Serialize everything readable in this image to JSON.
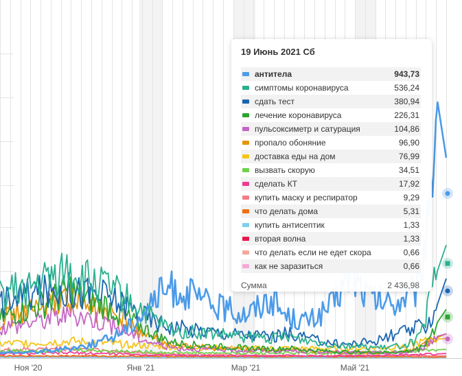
{
  "chart_data": {
    "type": "line",
    "x_tick_labels": [
      "Ноя '20",
      "Янв '21",
      "Мар '21",
      "Май '21"
    ],
    "x_range": [
      "2020-10-01",
      "2021-06-25"
    ],
    "y_range": [
      0,
      1100
    ],
    "grid": "vertical-weekly",
    "weekend_shading": true,
    "tooltip": {
      "date_label": "19 Июнь 2021 Сб",
      "total_label": "Сумма",
      "total_value": "2 436,98"
    },
    "series": [
      {
        "name": "антитела",
        "color": "#4c9be8",
        "value_label": "943,73",
        "values": [
          20,
          21,
          22,
          24,
          25,
          28,
          30,
          35,
          40,
          45,
          50,
          60,
          70,
          85,
          110,
          130,
          165,
          205,
          240,
          265,
          270,
          260,
          240,
          225,
          210,
          200,
          190,
          180,
          175,
          190,
          215,
          240,
          190,
          160,
          150,
          145,
          155,
          180,
          210,
          270,
          330,
          290,
          240,
          225,
          215,
          210,
          230,
          250,
          270,
          620,
          1000,
          780
        ]
      },
      {
        "name": "симптомы коронавируса",
        "color": "#2ab08f",
        "value_label": "536,24",
        "values": [
          240,
          255,
          265,
          270,
          280,
          300,
          310,
          330,
          350,
          310,
          300,
          290,
          275,
          260,
          240,
          215,
          195,
          165,
          140,
          120,
          105,
          100,
          100,
          95,
          95,
          90,
          90,
          85,
          80,
          80,
          80,
          75,
          80,
          90,
          75,
          70,
          65,
          60,
          55,
          50,
          50,
          45,
          45,
          40,
          40,
          45,
          50,
          60,
          80,
          200,
          340,
          440
        ]
      },
      {
        "name": "сдать тест",
        "color": "#1a65b0",
        "value_label": "380,94",
        "values": [
          210,
          230,
          240,
          245,
          250,
          255,
          260,
          270,
          265,
          260,
          255,
          250,
          245,
          230,
          215,
          195,
          175,
          155,
          140,
          130,
          120,
          115,
          110,
          110,
          105,
          100,
          95,
          95,
          90,
          90,
          90,
          85,
          90,
          100,
          90,
          80,
          70,
          65,
          60,
          55,
          55,
          60,
          65,
          70,
          80,
          90,
          100,
          110,
          120,
          140,
          210,
          310
        ]
      },
      {
        "name": "лечение коронавируса",
        "color": "#2ca531",
        "value_label": "226,31",
        "values": [
          150,
          165,
          175,
          185,
          200,
          210,
          225,
          245,
          270,
          240,
          225,
          215,
          205,
          190,
          170,
          145,
          125,
          105,
          85,
          70,
          60,
          55,
          52,
          50,
          48,
          45,
          43,
          42,
          40,
          38,
          37,
          35,
          36,
          40,
          35,
          32,
          30,
          28,
          26,
          25,
          25,
          24,
          23,
          22,
          22,
          23,
          25,
          30,
          40,
          80,
          140,
          190
        ]
      },
      {
        "name": "пульсоксиметр и сатурация",
        "color": "#c466c4",
        "value_label": "104,86",
        "values": [
          120,
          125,
          130,
          140,
          145,
          150,
          160,
          165,
          170,
          165,
          160,
          150,
          140,
          125,
          110,
          95,
          80,
          65,
          55,
          45,
          40,
          38,
          36,
          35,
          34,
          33,
          32,
          31,
          30,
          30,
          29,
          28,
          28,
          30,
          28,
          26,
          25,
          24,
          23,
          22,
          22,
          22,
          21,
          21,
          20,
          21,
          22,
          25,
          35,
          60,
          85,
          95
        ]
      },
      {
        "name": "пропало обоняние",
        "color": "#e6950c",
        "value_label": "96,90",
        "values": [
          150,
          165,
          175,
          180,
          190,
          195,
          210,
          230,
          240,
          215,
          200,
          190,
          175,
          160,
          145,
          125,
          105,
          85,
          70,
          55,
          48,
          45,
          43,
          42,
          40,
          38,
          36,
          35,
          34,
          33,
          32,
          30,
          31,
          33,
          30,
          28,
          26,
          25,
          24,
          23,
          22,
          22,
          21,
          21,
          20,
          22,
          25,
          30,
          40,
          60,
          80,
          95
        ]
      },
      {
        "name": "доставка еды на дом",
        "color": "#f5c518",
        "value_label": "76,99",
        "values": [
          55,
          57,
          58,
          60,
          60,
          62,
          63,
          64,
          66,
          64,
          62,
          60,
          58,
          56,
          54,
          52,
          50,
          48,
          46,
          44,
          43,
          42,
          41,
          40,
          40,
          40,
          39,
          39,
          38,
          38,
          38,
          38,
          38,
          39,
          38,
          38,
          37,
          37,
          37,
          37,
          38,
          38,
          39,
          40,
          41,
          43,
          46,
          52,
          60,
          68,
          74,
          77
        ]
      },
      {
        "name": "вызвать скорую",
        "color": "#6fd24a",
        "value_label": "34,51",
        "values": [
          26,
          27,
          28,
          29,
          30,
          30,
          31,
          32,
          33,
          32,
          31,
          30,
          29,
          28,
          27,
          26,
          25,
          24,
          23,
          22,
          22,
          21,
          21,
          21,
          20,
          20,
          20,
          20,
          20,
          20,
          20,
          20,
          20,
          20,
          20,
          20,
          20,
          20,
          20,
          20,
          20,
          21,
          21,
          22,
          23,
          24,
          25,
          27,
          29,
          31,
          33,
          34
        ]
      },
      {
        "name": "сделать КТ",
        "color": "#ee3c96",
        "value_label": "17,92",
        "values": [
          16,
          17,
          17,
          18,
          18,
          19,
          19,
          20,
          21,
          20,
          19,
          18,
          18,
          17,
          16,
          15,
          14,
          13,
          12,
          11,
          11,
          10,
          10,
          10,
          10,
          10,
          10,
          9,
          9,
          9,
          9,
          9,
          9,
          10,
          9,
          9,
          9,
          9,
          9,
          9,
          9,
          9,
          9,
          10,
          10,
          11,
          12,
          13,
          14,
          15,
          17,
          18
        ]
      },
      {
        "name": "купить маску и респиратор",
        "color": "#f67c88",
        "value_label": "9,29",
        "values": [
          30,
          32,
          33,
          34,
          35,
          36,
          37,
          38,
          38,
          36,
          34,
          32,
          30,
          28,
          26,
          24,
          22,
          20,
          18,
          17,
          16,
          15,
          15,
          14,
          14,
          13,
          13,
          13,
          12,
          12,
          12,
          11,
          11,
          11,
          11,
          10,
          10,
          10,
          10,
          10,
          10,
          10,
          10,
          10,
          10,
          10,
          10,
          10,
          9,
          9,
          9,
          9
        ]
      },
      {
        "name": "что делать дома",
        "color": "#f26e12",
        "value_label": "5,31",
        "values": [
          8,
          8,
          8,
          9,
          9,
          9,
          9,
          9,
          9,
          9,
          9,
          9,
          8,
          8,
          8,
          8,
          8,
          7,
          7,
          7,
          7,
          7,
          7,
          6,
          6,
          6,
          6,
          6,
          6,
          6,
          6,
          6,
          6,
          6,
          6,
          6,
          6,
          6,
          6,
          6,
          6,
          6,
          6,
          6,
          6,
          6,
          6,
          6,
          6,
          5,
          5,
          5
        ]
      },
      {
        "name": "купить антисептик",
        "color": "#7fd0ee",
        "value_label": "1,33",
        "values": [
          4,
          4,
          4,
          4,
          4,
          4,
          4,
          4,
          4,
          4,
          4,
          4,
          3,
          3,
          3,
          3,
          3,
          3,
          3,
          3,
          3,
          3,
          3,
          2,
          2,
          2,
          2,
          2,
          2,
          2,
          2,
          2,
          2,
          2,
          2,
          2,
          2,
          2,
          2,
          2,
          2,
          2,
          2,
          2,
          2,
          2,
          2,
          2,
          2,
          1,
          1,
          1
        ]
      },
      {
        "name": "вторая волна",
        "color": "#e8174f",
        "value_label": "1,33",
        "values": [
          6,
          6,
          7,
          7,
          7,
          7,
          7,
          7,
          7,
          6,
          6,
          6,
          5,
          5,
          5,
          4,
          4,
          4,
          3,
          3,
          3,
          3,
          3,
          2,
          2,
          2,
          2,
          2,
          2,
          2,
          2,
          2,
          2,
          2,
          2,
          2,
          2,
          2,
          2,
          2,
          2,
          2,
          2,
          2,
          2,
          2,
          2,
          2,
          2,
          1,
          1,
          1
        ]
      },
      {
        "name": "что делать если не едет скорая",
        "color": "#f2a99c",
        "value_label": "0,66",
        "values": [
          3,
          3,
          3,
          3,
          3,
          3,
          3,
          3,
          3,
          3,
          3,
          3,
          2,
          2,
          2,
          2,
          2,
          2,
          2,
          2,
          2,
          2,
          2,
          2,
          2,
          1,
          1,
          1,
          1,
          1,
          1,
          1,
          1,
          1,
          1,
          1,
          1,
          1,
          1,
          1,
          1,
          1,
          1,
          1,
          1,
          1,
          1,
          1,
          1,
          1,
          1,
          1
        ]
      },
      {
        "name": "как не заразиться",
        "color": "#f7a8d8",
        "value_label": "0,66",
        "values": [
          4,
          4,
          4,
          4,
          4,
          4,
          4,
          4,
          4,
          4,
          3,
          3,
          3,
          3,
          3,
          3,
          2,
          2,
          2,
          2,
          2,
          2,
          2,
          2,
          2,
          1,
          1,
          1,
          1,
          1,
          1,
          1,
          1,
          1,
          1,
          1,
          1,
          1,
          1,
          1,
          1,
          1,
          1,
          1,
          1,
          1,
          1,
          1,
          1,
          1,
          1,
          1
        ]
      }
    ]
  }
}
